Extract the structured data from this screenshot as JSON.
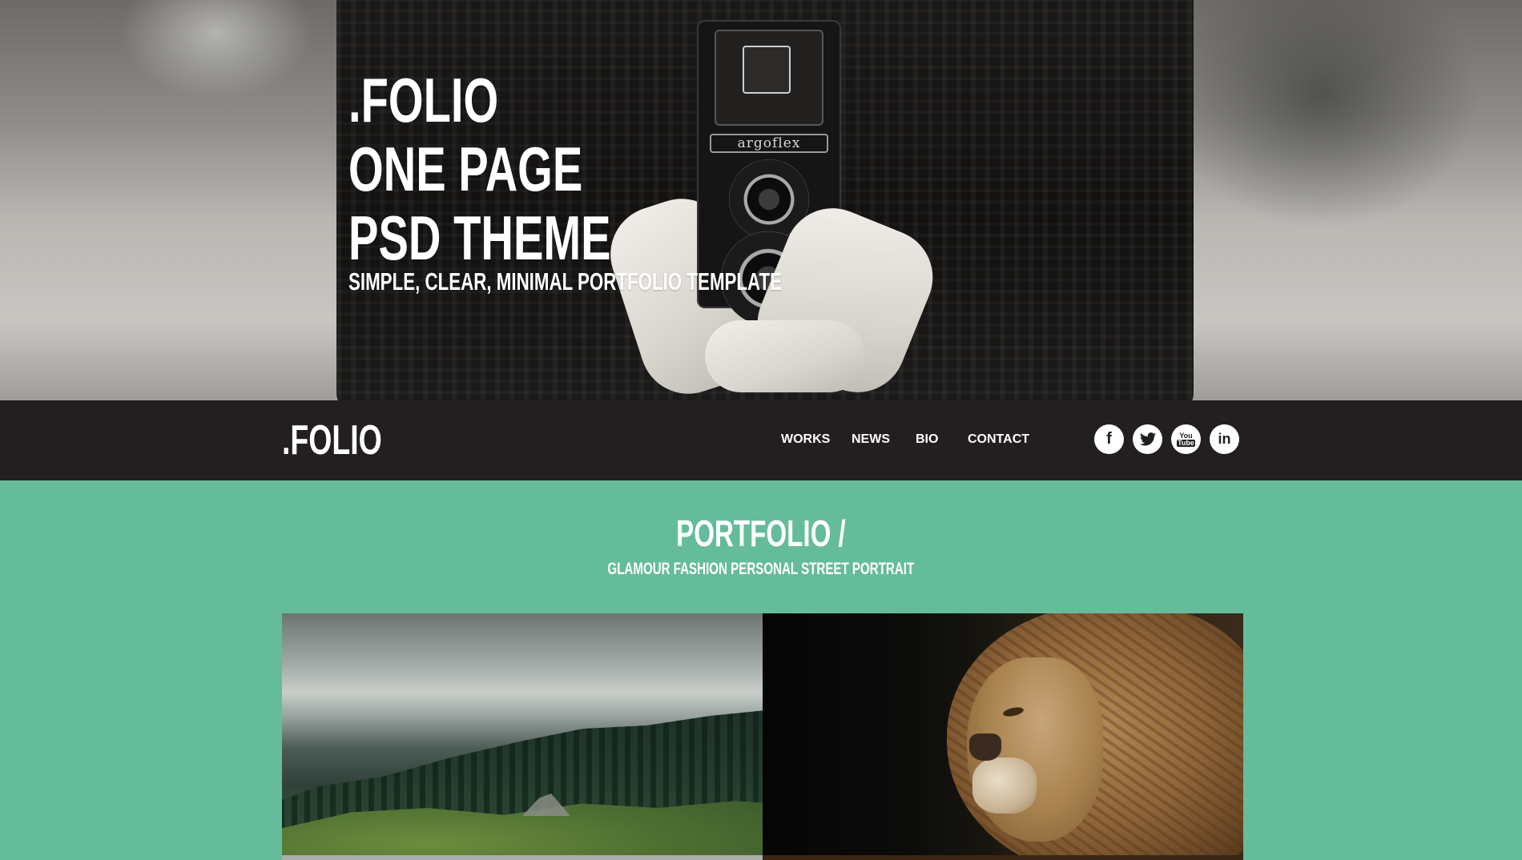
{
  "hero": {
    "title_lines": [
      ".FOLIO",
      "ONE PAGE",
      "PSD THEME"
    ],
    "tagline": "SIMPLE, CLEAR, MINIMAL PORTFOLIO TEMPLATE",
    "camera_brand": "argoflex"
  },
  "navbar": {
    "logo": ".FOLIO",
    "menu": [
      "WORKS",
      "NEWS",
      "BIO",
      "CONTACT"
    ],
    "social": [
      {
        "icon": "facebook-icon",
        "glyph": "f"
      },
      {
        "icon": "twitter-icon",
        "glyph": "🐦"
      },
      {
        "icon": "youtube-icon",
        "glyph_top": "You",
        "glyph_bottom": "Tube"
      },
      {
        "icon": "linkedin-icon",
        "glyph": "in"
      }
    ],
    "background_color": "#231f20"
  },
  "portfolio": {
    "title": "PORTFOLIO /",
    "subtitle": "GLAMOUR FASHION PERSONAL STREET PORTRAIT",
    "items": [
      {
        "name": "forest-photo"
      },
      {
        "name": "lion-photo"
      }
    ],
    "background_color": "#65bc9b"
  }
}
